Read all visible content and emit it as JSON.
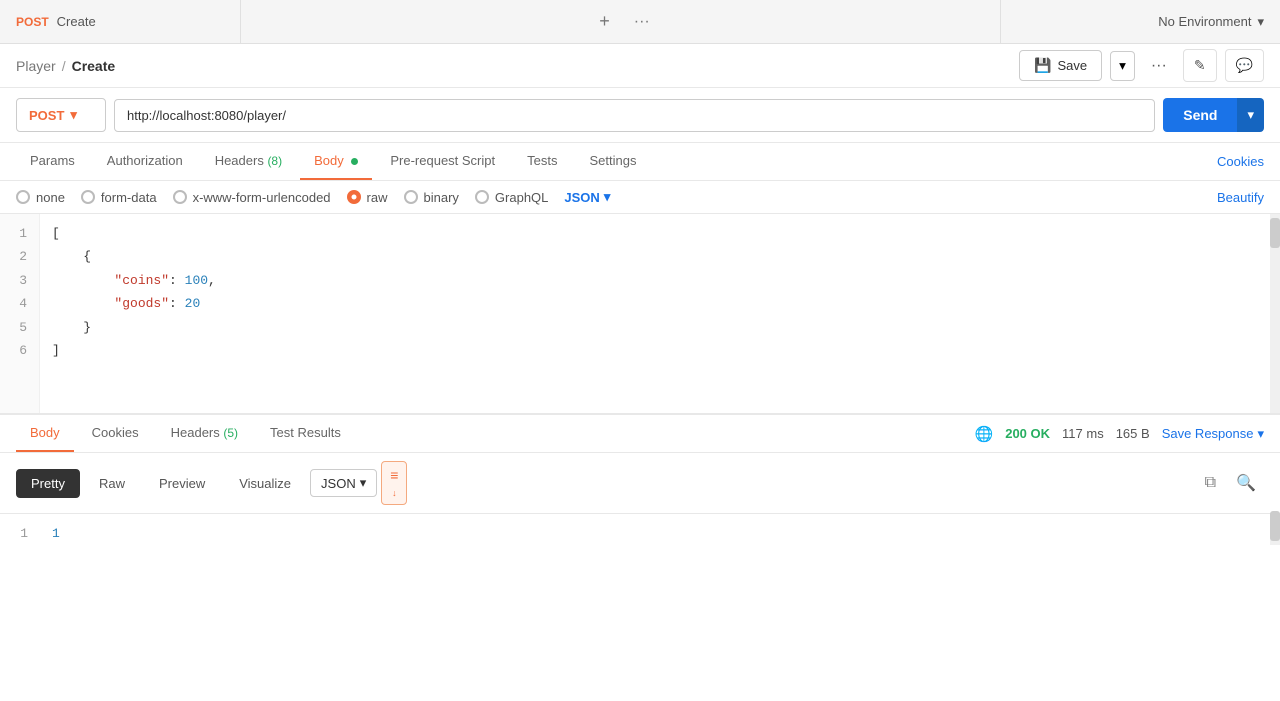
{
  "topbar": {
    "method": "POST",
    "title": "Create",
    "new_tab_icon": "+",
    "more_icon": "···",
    "env_label": "No Environment",
    "chevron_down": "▾"
  },
  "breadcrumb": {
    "parent": "Player",
    "separator": "/",
    "current": "Create"
  },
  "toolbar": {
    "save_label": "Save",
    "more_icon": "···",
    "edit_icon": "✎",
    "comment_icon": "☐"
  },
  "url_bar": {
    "method": "POST",
    "url": "http://localhost:8080/player/",
    "send_label": "Send"
  },
  "request_tabs": [
    {
      "label": "Params",
      "active": false,
      "badge": null,
      "dot": false
    },
    {
      "label": "Authorization",
      "active": false,
      "badge": null,
      "dot": false
    },
    {
      "label": "Headers",
      "active": false,
      "badge": "(8)",
      "dot": false
    },
    {
      "label": "Body",
      "active": true,
      "badge": null,
      "dot": true
    },
    {
      "label": "Pre-request Script",
      "active": false,
      "badge": null,
      "dot": false
    },
    {
      "label": "Tests",
      "active": false,
      "badge": null,
      "dot": false
    },
    {
      "label": "Settings",
      "active": false,
      "badge": null,
      "dot": false
    }
  ],
  "cookies_link": "Cookies",
  "body_options": [
    {
      "id": "none",
      "label": "none",
      "selected": false
    },
    {
      "id": "form-data",
      "label": "form-data",
      "selected": false
    },
    {
      "id": "x-www-form-urlencoded",
      "label": "x-www-form-urlencoded",
      "selected": false
    },
    {
      "id": "raw",
      "label": "raw",
      "selected": true
    },
    {
      "id": "binary",
      "label": "binary",
      "selected": false
    },
    {
      "id": "GraphQL",
      "label": "GraphQL",
      "selected": false
    }
  ],
  "format_label": "JSON",
  "beautify_label": "Beautify",
  "code_lines": [
    {
      "num": 1,
      "content": "["
    },
    {
      "num": 2,
      "content": "    {"
    },
    {
      "num": 3,
      "content": "        \"coins\": 100,"
    },
    {
      "num": 4,
      "content": "        \"goods\": 20"
    },
    {
      "num": 5,
      "content": "    }"
    },
    {
      "num": 6,
      "content": "]"
    }
  ],
  "response": {
    "tabs": [
      {
        "label": "Body",
        "active": true,
        "badge": null
      },
      {
        "label": "Cookies",
        "active": false,
        "badge": null
      },
      {
        "label": "Headers",
        "active": false,
        "badge": "(5)"
      },
      {
        "label": "Test Results",
        "active": false,
        "badge": null
      }
    ],
    "globe_icon": "🌐",
    "status": "200 OK",
    "time": "117 ms",
    "size": "165 B",
    "save_response_label": "Save Response",
    "view_options": [
      "Pretty",
      "Raw",
      "Preview",
      "Visualize"
    ],
    "active_view": "Pretty",
    "format_label": "JSON",
    "resp_line": {
      "num": 1,
      "content": "1"
    }
  }
}
